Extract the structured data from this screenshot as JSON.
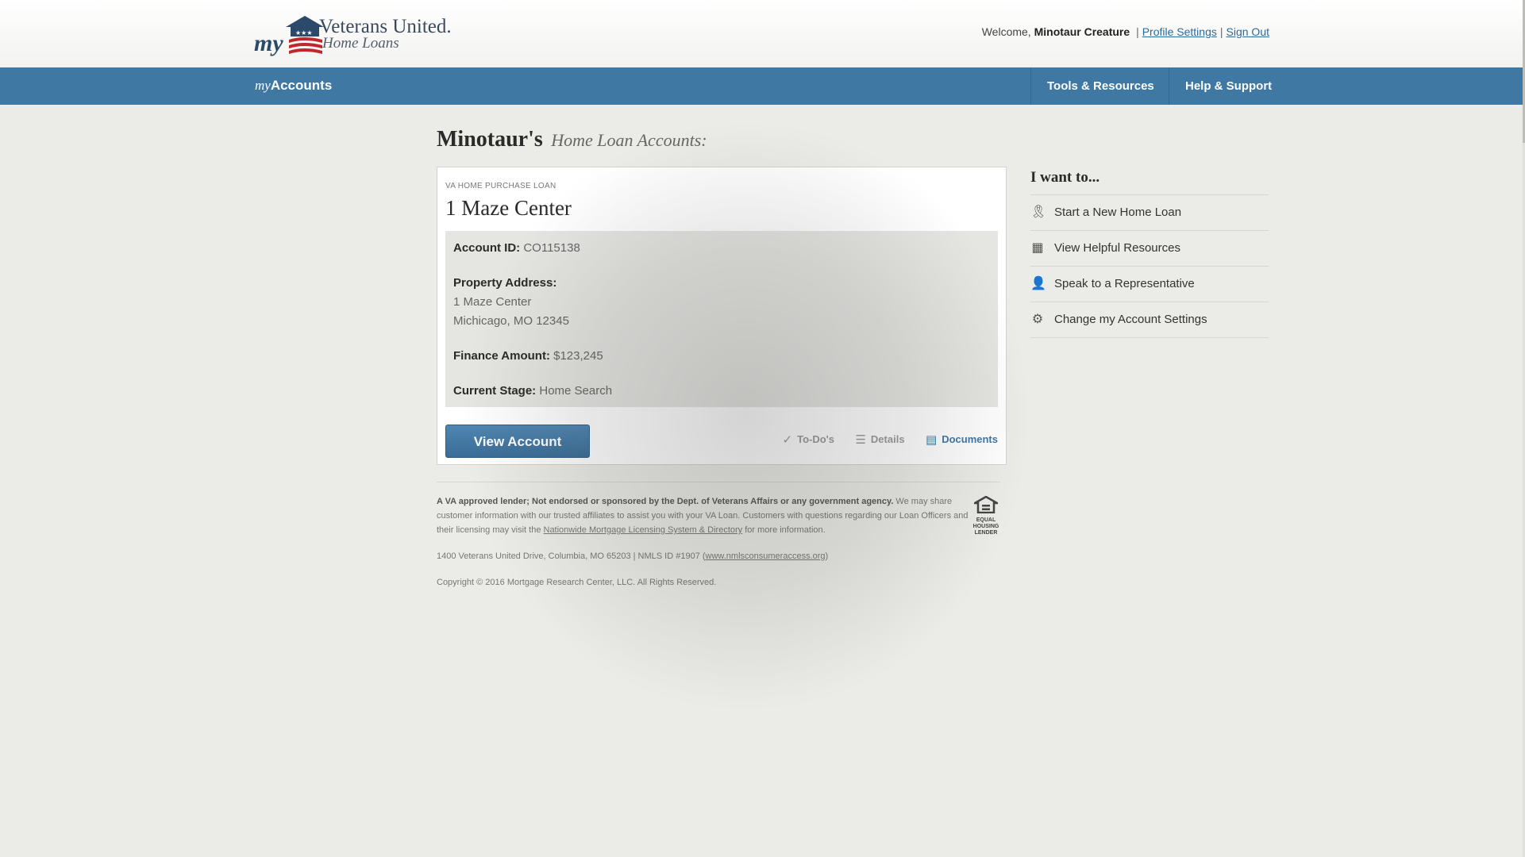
{
  "header": {
    "logo": {
      "my_mark": "my",
      "title": "Veterans United.",
      "subtitle": "Home Loans"
    },
    "welcome_prefix": "Welcome,",
    "user_name": "Minotaur Creature",
    "profile_link": "Profile Settings",
    "separator": "|",
    "signout_link": "Sign Out"
  },
  "nav": {
    "brand_my": "my",
    "brand_accounts": "Accounts",
    "items": [
      {
        "label": "Tools & Resources"
      },
      {
        "label": "Help & Support"
      }
    ]
  },
  "main": {
    "title_name": "Minotaur's",
    "title_sub": "Home Loan Accounts:"
  },
  "account": {
    "loan_type": "VA HOME PURCHASE LOAN",
    "name": "1 Maze Center",
    "account_id_label": "Account ID:",
    "account_id": "CO115138",
    "property_label": "Property Address:",
    "address_line1": "1 Maze Center",
    "address_line2": "Michicago, MO 12345",
    "finance_label": "Finance Amount:",
    "finance_amount": "$123,245",
    "stage_label": "Current Stage:",
    "stage": "Home Search",
    "view_button": "View Account",
    "links": {
      "todos": "To-Do's",
      "details": "Details",
      "documents": "Documents"
    }
  },
  "sidebar": {
    "title": "I want to...",
    "items": [
      {
        "label": "Start a New Home Loan",
        "icon": "ribbon-icon"
      },
      {
        "label": "View Helpful Resources",
        "icon": "newspaper-icon"
      },
      {
        "label": "Speak to a Representative",
        "icon": "person-icon"
      },
      {
        "label": "Change my Account Settings",
        "icon": "gear-icon"
      }
    ]
  },
  "footer": {
    "disclaimer_bold": "A VA approved lender; Not endorsed or sponsored by the Dept. of Veterans Affairs or any government agency.",
    "disclaimer_text": " We may share customer information with our trusted affiliates to assist you with your VA Loan. Customers with questions regarding our Loan Officers and their licensing may visit the ",
    "disclaimer_link": "Nationwide Mortgage Licensing System & Directory",
    "disclaimer_end": " for more information.",
    "address": "1400 Veterans United Drive, Columbia, MO 65203 | NMLS ID #1907 (",
    "nmls_link": "www.nmlsconsumeraccess.org",
    "address_end": ")",
    "copyright": "Copyright © 2016 Mortgage Research Center, LLC. All Rights Reserved.",
    "ehl_label": "EQUAL HOUSING LENDER"
  },
  "colors": {
    "nav_bg": "#3f78a3",
    "button_bg": "#3a6d97",
    "page_bg": "#ebebe7"
  }
}
